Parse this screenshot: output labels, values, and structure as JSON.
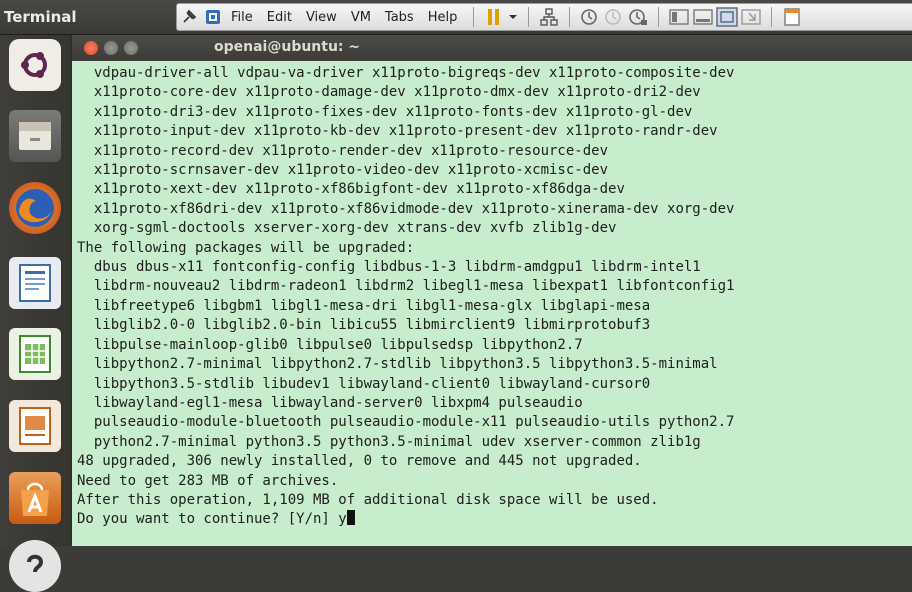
{
  "top_panel": {
    "app_title": "Terminal",
    "menu": [
      "File",
      "Edit",
      "View",
      "VM",
      "Tabs",
      "Help"
    ]
  },
  "launcher": {
    "items": [
      "ubuntu-dash-icon",
      "files-icon",
      "firefox-icon",
      "writer-icon",
      "calc-icon",
      "impress-icon",
      "software-center-icon",
      "help-icon"
    ]
  },
  "terminal": {
    "title": "openai@ubuntu: ~",
    "lines": [
      "  vdpau-driver-all vdpau-va-driver x11proto-bigreqs-dev x11proto-composite-dev",
      "  x11proto-core-dev x11proto-damage-dev x11proto-dmx-dev x11proto-dri2-dev",
      "  x11proto-dri3-dev x11proto-fixes-dev x11proto-fonts-dev x11proto-gl-dev",
      "  x11proto-input-dev x11proto-kb-dev x11proto-present-dev x11proto-randr-dev",
      "  x11proto-record-dev x11proto-render-dev x11proto-resource-dev",
      "  x11proto-scrnsaver-dev x11proto-video-dev x11proto-xcmisc-dev",
      "  x11proto-xext-dev x11proto-xf86bigfont-dev x11proto-xf86dga-dev",
      "  x11proto-xf86dri-dev x11proto-xf86vidmode-dev x11proto-xinerama-dev xorg-dev",
      "  xorg-sgml-doctools xserver-xorg-dev xtrans-dev xvfb zlib1g-dev",
      "The following packages will be upgraded:",
      "  dbus dbus-x11 fontconfig-config libdbus-1-3 libdrm-amdgpu1 libdrm-intel1",
      "  libdrm-nouveau2 libdrm-radeon1 libdrm2 libegl1-mesa libexpat1 libfontconfig1",
      "  libfreetype6 libgbm1 libgl1-mesa-dri libgl1-mesa-glx libglapi-mesa",
      "  libglib2.0-0 libglib2.0-bin libicu55 libmirclient9 libmirprotobuf3",
      "  libpulse-mainloop-glib0 libpulse0 libpulsedsp libpython2.7",
      "  libpython2.7-minimal libpython2.7-stdlib libpython3.5 libpython3.5-minimal",
      "  libpython3.5-stdlib libudev1 libwayland-client0 libwayland-cursor0",
      "  libwayland-egl1-mesa libwayland-server0 libxpm4 pulseaudio",
      "  pulseaudio-module-bluetooth pulseaudio-module-x11 pulseaudio-utils python2.7",
      "  python2.7-minimal python3.5 python3.5-minimal udev xserver-common zlib1g",
      "48 upgraded, 306 newly installed, 0 to remove and 445 not upgraded.",
      "Need to get 283 MB of archives.",
      "After this operation, 1,109 MB of additional disk space will be used."
    ],
    "prompt": "Do you want to continue? [Y/n] ",
    "input": "y"
  }
}
